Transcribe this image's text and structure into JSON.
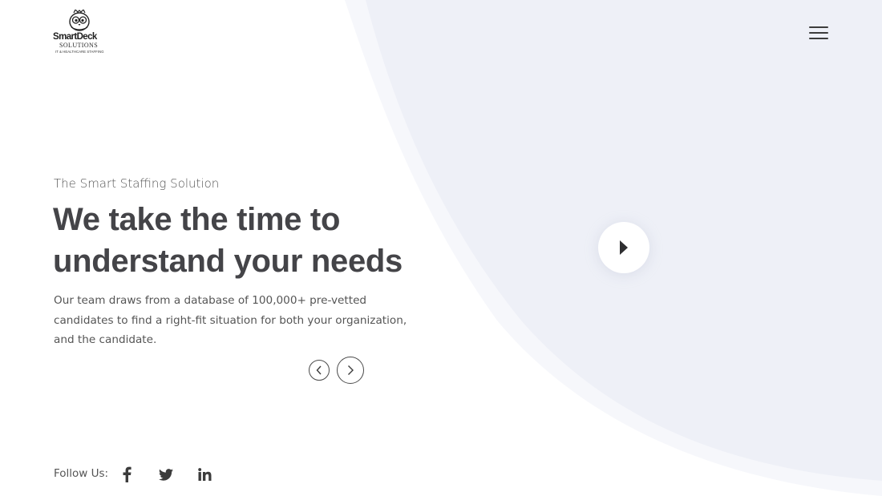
{
  "header": {
    "logo": {
      "brand": "SmartDeck",
      "sub": "SOLUTIONS",
      "tagline": "IT & HEALTHCARE STAFFING"
    },
    "menu_icon": "hamburger-menu-icon"
  },
  "hero": {
    "eyebrow": "The Smart Staffing Solution",
    "headline_line1": "We take the time to",
    "headline_line2": "understand your needs",
    "description": "Our team draws from a database of 100,000+ pre-vetted candidates to find a right-fit situation for both your organization, and the candidate.",
    "prev_icon": "chevron-left-icon",
    "next_icon": "chevron-right-icon"
  },
  "video": {
    "play_icon": "play-icon"
  },
  "social": {
    "label": "Follow Us:",
    "links": [
      "facebook-icon",
      "twitter-icon",
      "linkedin-icon"
    ]
  },
  "colors": {
    "background": "#ffffff",
    "accent_shape": "#eef0f7",
    "heading": "#444448",
    "body_text": "#555555",
    "icon": "#3c3c3c"
  }
}
